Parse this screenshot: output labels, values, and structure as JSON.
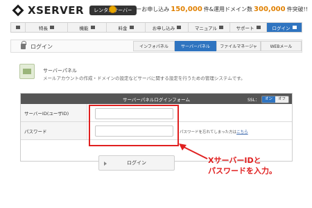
{
  "header": {
    "brand": "XSERVER",
    "badge": "レンタルサーバー",
    "promo": {
      "prefix": "サーバーお申し込み",
      "apps": "150,000",
      "middle": "件&運用ドメイン数",
      "domains": "300,000",
      "suffix": "件突破!!"
    }
  },
  "nav": {
    "items": [
      {
        "label": "",
        "icon": "home-icon"
      },
      {
        "label": "特長",
        "icon": "monitor-icon"
      },
      {
        "label": "機能",
        "icon": "mouse-icon"
      },
      {
        "label": "料金",
        "icon": "tag-icon"
      },
      {
        "label": "お申し込み",
        "icon": "pencil-icon"
      },
      {
        "label": "マニュアル",
        "icon": "book-icon"
      },
      {
        "label": "サポート",
        "icon": "person-icon"
      },
      {
        "label": "ログイン",
        "icon": "lock-icon"
      }
    ]
  },
  "section": {
    "title": "ログイン",
    "tabs": [
      "インフォパネル",
      "サーバーパネル",
      "ファイルマネージャ",
      "WEBメール"
    ]
  },
  "service": {
    "name": "サーバーパネル",
    "description": "メールアカウントの作成・ドメインの設定などサーバに関する設定を行うための管理システムです。"
  },
  "login_form": {
    "title": "サーバーパネルログインフォーム",
    "ssl_label": "SSL：",
    "ssl_on": "オン",
    "ssl_off": "オフ",
    "server_id_label": "サーバーID(ユーザID)",
    "server_id_value": "",
    "password_label": "パスワード",
    "password_value": "",
    "forgot_text": "パスワードを忘れてしまった方は",
    "forgot_link": "こちら",
    "login_button": "ログイン"
  },
  "annotation": {
    "line1": "XサーバーIDと",
    "line2": "パスワードを入力。",
    "color": "#e02020"
  }
}
